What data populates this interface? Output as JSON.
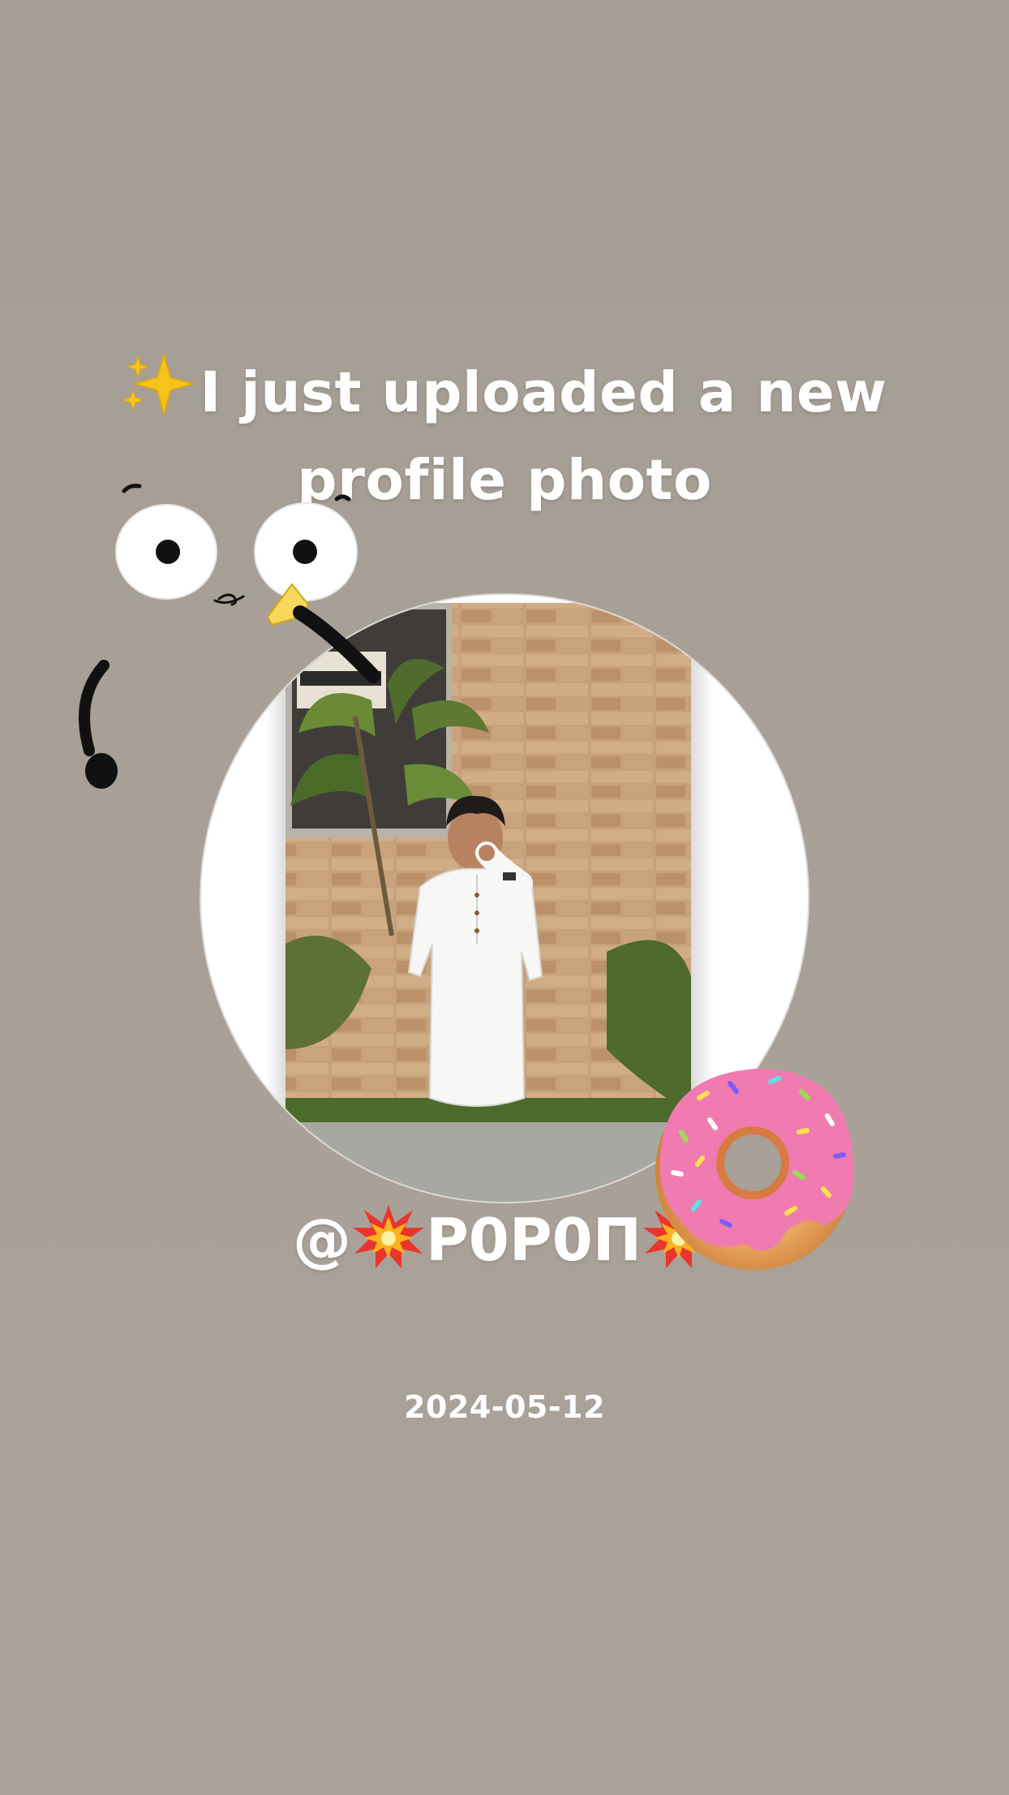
{
  "headline": {
    "line1": "I just uploaded a new",
    "line2": "profile photo",
    "leading_emoji": "sparkles-icon"
  },
  "profile": {
    "username_prefix": "@",
    "username": "P0P0П",
    "decorations": [
      "collision-icon",
      "collision-icon"
    ],
    "photo_alt": "profile-photo"
  },
  "post": {
    "date": "2024-05-12"
  },
  "stickers": [
    "cartoon-face-sticker",
    "donut-sticker"
  ],
  "colors": {
    "background": "#a8a097",
    "text": "#ffffff",
    "circle_border": "#ffffff",
    "donut_icing": "#f07bb0"
  }
}
